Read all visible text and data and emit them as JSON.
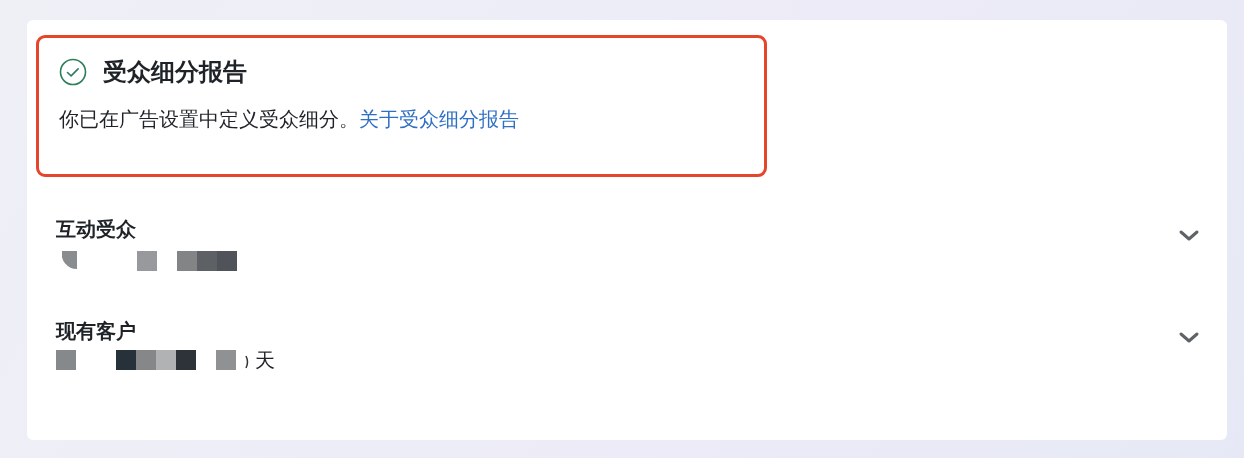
{
  "notice": {
    "title": "受众细分报告",
    "complete": true,
    "text": "你已在广告设置中定义受众细分。",
    "link": "关于受众细分报告"
  },
  "sections": [
    {
      "title": "互动受众",
      "expanded": false
    },
    {
      "title": "现有客户",
      "expanded": false,
      "detail_tail": "天"
    }
  ]
}
